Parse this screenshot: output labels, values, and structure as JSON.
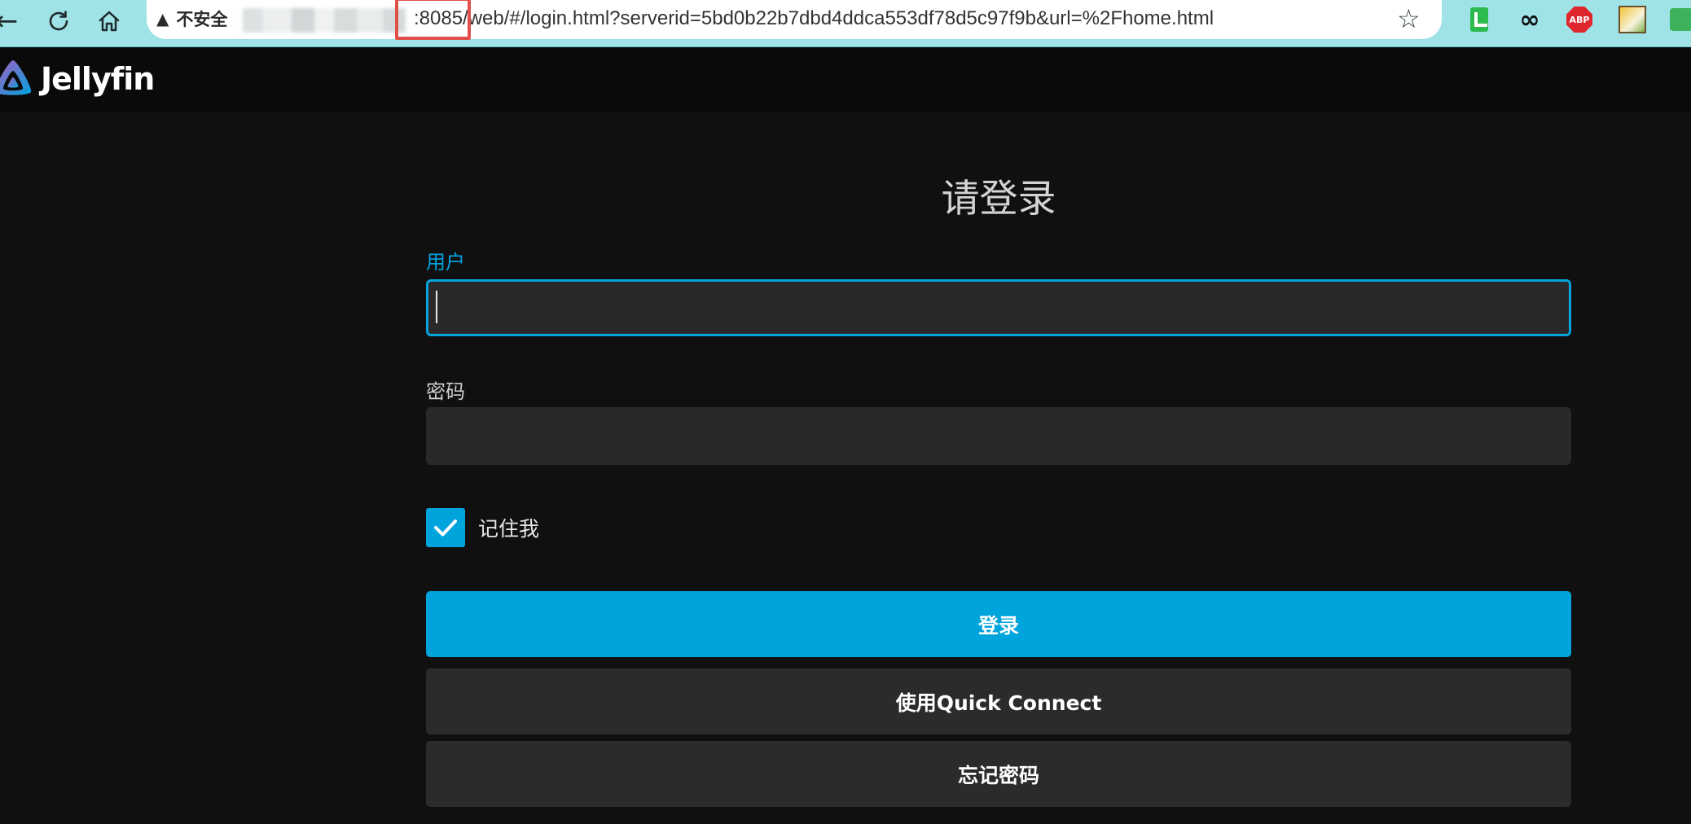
{
  "browser": {
    "security_label": "不安全",
    "url": ":8085/web/#/login.html?serverid=5bd0b22b7dbd4ddca553df78d5c97f9b&url=%2Fhome.html",
    "extensions": [
      "sheets-icon",
      "infinity-icon",
      "adblock-plus-icon",
      "image-extension-icon",
      "green-extension-icon"
    ],
    "abp_label": "ABP",
    "infinity_glyph": "∞"
  },
  "app": {
    "name": "Jellyfin",
    "brand_colors": [
      "#aa5cc3",
      "#00a4dc"
    ]
  },
  "login": {
    "title": "请登录",
    "username_label": "用户",
    "username_value": "",
    "password_label": "密码",
    "password_value": "",
    "remember_label": "记住我",
    "remember_checked": true,
    "login_button": "登录",
    "quick_connect_button": "使用Quick Connect",
    "forgot_password_button": "忘记密码"
  },
  "colors": {
    "accent": "#00a4dc",
    "background": "#101010",
    "input_background": "#292929",
    "url_highlight": "#e0504a"
  }
}
